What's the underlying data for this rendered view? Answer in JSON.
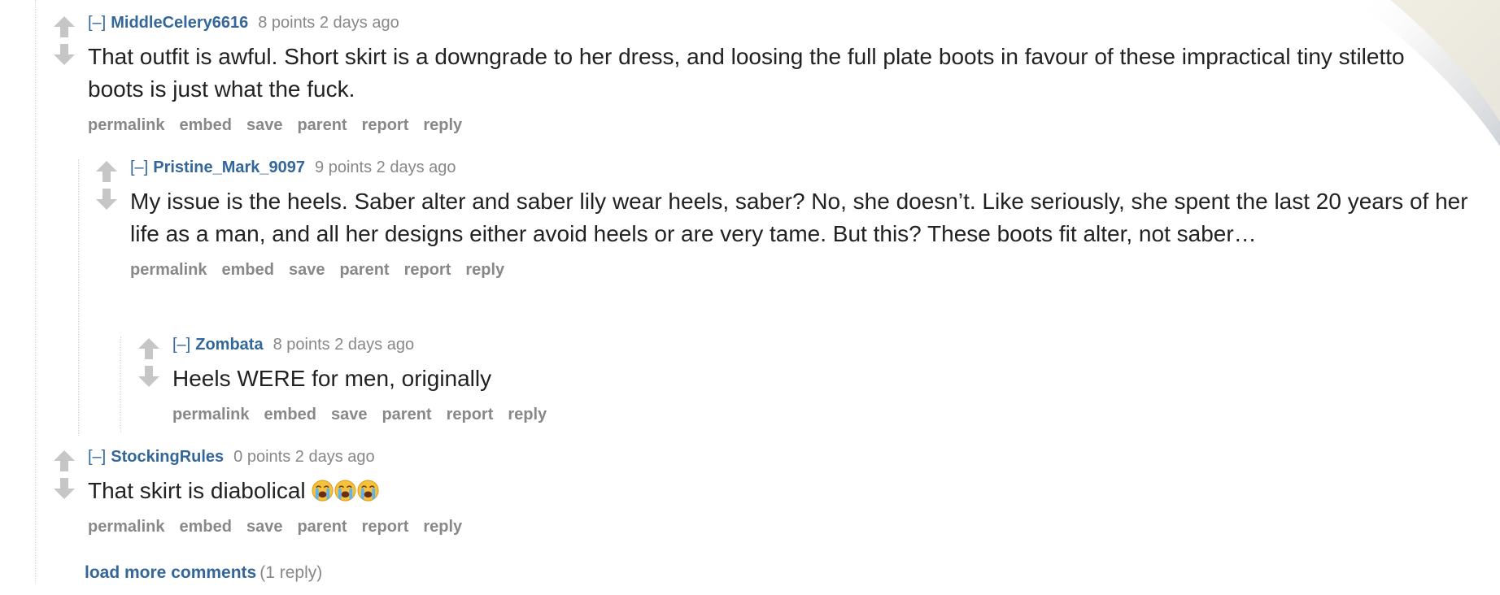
{
  "buttons": {
    "permalink": "permalink",
    "embed": "embed",
    "save": "save",
    "parent": "parent",
    "report": "report",
    "reply": "reply"
  },
  "comments": [
    {
      "expand": "[–]",
      "author": "MiddleCelery6616",
      "points": "8 points",
      "time": "2 days ago",
      "body": "That outfit is awful. Short skirt is a downgrade to her dress, and loosing the full plate boots in favour of these impractical tiny stiletto boots is just what the fuck."
    },
    {
      "expand": "[–]",
      "author": "Pristine_Mark_9097",
      "points": "9 points",
      "time": "2 days ago",
      "body": "My issue is the heels. Saber alter and saber lily wear heels, saber? No, she doesn’t. Like seriously, she spent the last 20 years of her life as a man, and all her designs either avoid heels or are very tame. But this? These boots fit alter, not saber…"
    },
    {
      "expand": "[–]",
      "author": "Zombata",
      "points": "8 points",
      "time": "2 days ago",
      "body": "Heels WERE for men, originally"
    },
    {
      "expand": "[–]",
      "author": "StockingRules",
      "points": "0 points",
      "time": "2 days ago",
      "body": "That skirt is diabolical",
      "emoji": [
        "loudly-crying-face-emoji",
        "loudly-crying-face-emoji",
        "loudly-crying-face-emoji"
      ]
    }
  ],
  "load_more": {
    "link": "load more comments",
    "count": "(1 reply)"
  },
  "icons": {
    "upvote": "upvote-arrow-icon",
    "downvote": "downvote-arrow-icon"
  },
  "colors": {
    "link_blue": "#336699",
    "meta_gray": "#888888",
    "arrow_gray": "#c6c6c6",
    "text": "#222222"
  }
}
